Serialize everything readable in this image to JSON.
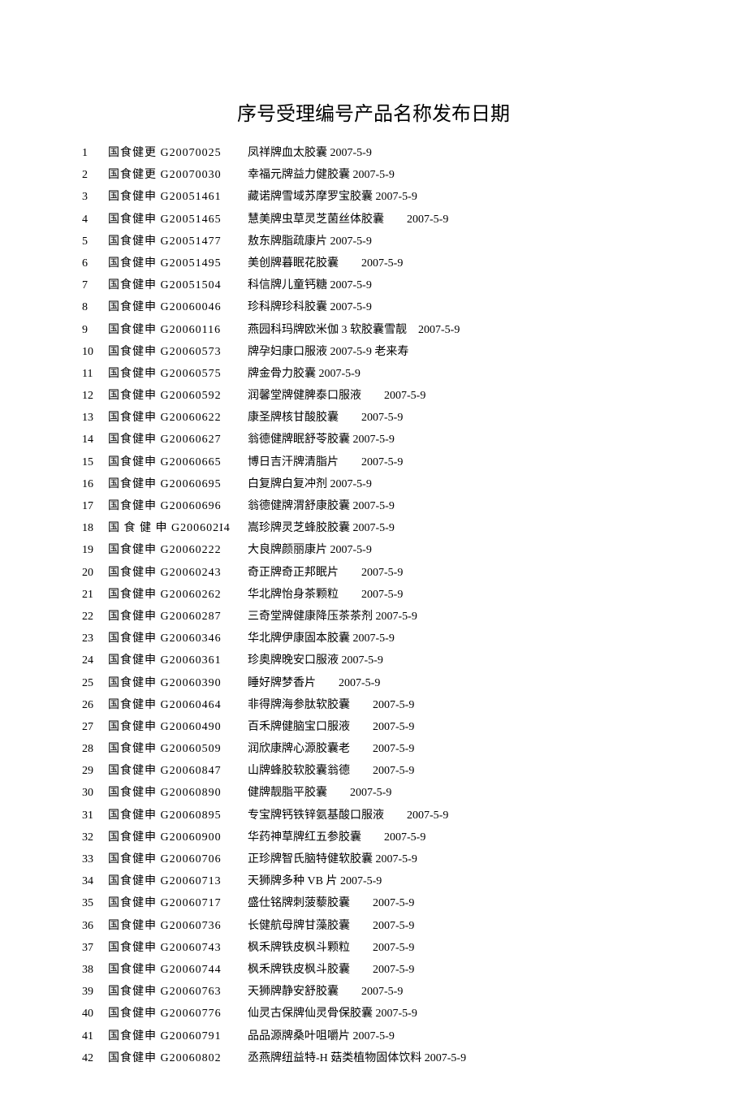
{
  "title": "序号受理编号产品名称发布日期",
  "rows": [
    {
      "seq": "1",
      "code": "国食健更 G20070025",
      "desc": "凤祥牌血太胶囊 2007-5-9"
    },
    {
      "seq": "2",
      "code": "国食健更 G20070030",
      "desc": "幸福元牌益力健胶囊 2007-5-9"
    },
    {
      "seq": "3",
      "code": "国食健申 G20051461",
      "desc": "藏诺牌雪域苏摩罗宝胶囊 2007-5-9"
    },
    {
      "seq": "4",
      "code": "国食健申 G20051465",
      "desc": "慧美牌虫草灵芝菌丝体胶囊　　2007-5-9"
    },
    {
      "seq": "5",
      "code": "国食健申 G20051477",
      "desc": "敖东牌脂疏康片 2007-5-9"
    },
    {
      "seq": "6",
      "code": "国食健申 G20051495",
      "desc": "美创牌暮眠花胶囊　　2007-5-9"
    },
    {
      "seq": "7",
      "code": "国食健申 G20051504",
      "desc": "科信牌儿童钙糖 2007-5-9"
    },
    {
      "seq": "8",
      "code": "国食健申 G20060046",
      "desc": "珍科牌珍科胶囊 2007-5-9"
    },
    {
      "seq": "9",
      "code": "国食健申 G20060116",
      "desc": "燕园科玛牌欧米伽 3 软胶囊雪靓　2007-5-9"
    },
    {
      "seq": "10",
      "code": "国食健申 G20060573",
      "desc": "牌孕妇康口服液 2007-5-9 老来寿"
    },
    {
      "seq": "11",
      "code": "国食健申 G20060575",
      "desc": "牌金骨力胶囊 2007-5-9"
    },
    {
      "seq": "12",
      "code": "国食健申 G20060592",
      "desc": "润馨堂牌健脾泰口服液　　2007-5-9"
    },
    {
      "seq": "13",
      "code": "国食健申 G20060622",
      "desc": "康圣牌核甘酸胶囊　　2007-5-9"
    },
    {
      "seq": "14",
      "code": "国食健申 G20060627",
      "desc": "翁德健牌眠舒苓胶囊 2007-5-9"
    },
    {
      "seq": "15",
      "code": "国食健申 G20060665",
      "desc": "博日吉汗牌清脂片　　2007-5-9"
    },
    {
      "seq": "16",
      "code": "国食健申 G20060695",
      "desc": "白复牌白复冲剂 2007-5-9"
    },
    {
      "seq": "17",
      "code": "国食健申 G20060696",
      "desc": "翁德健牌渭舒康胶囊 2007-5-9"
    },
    {
      "seq": "18",
      "code": "国 食 健 申 G200602I4",
      "desc": "嵩珍牌灵芝蜂胶胶囊 2007-5-9"
    },
    {
      "seq": "19",
      "code": "国食健申 G20060222",
      "desc": "大良牌颜丽康片 2007-5-9"
    },
    {
      "seq": "20",
      "code": "国食健申 G20060243",
      "desc": "奇正牌奇正邦眠片　　2007-5-9"
    },
    {
      "seq": "21",
      "code": "国食健申 G20060262",
      "desc": "华北牌怡身茶颗粒　　2007-5-9"
    },
    {
      "seq": "22",
      "code": "国食健申 G20060287",
      "desc": "三奇堂牌健康降压茶茶剂 2007-5-9"
    },
    {
      "seq": "23",
      "code": "国食健申 G20060346",
      "desc": "华北牌伊康固本胶囊 2007-5-9"
    },
    {
      "seq": "24",
      "code": "国食健申 G20060361",
      "desc": "珍奥牌晚安口服液 2007-5-9"
    },
    {
      "seq": "25",
      "code": "国食健申 G20060390",
      "desc": "睡好牌梦香片　　2007-5-9"
    },
    {
      "seq": "26",
      "code": "国食健申 G20060464",
      "desc": "非得牌海参肽软胶囊　　2007-5-9"
    },
    {
      "seq": "27",
      "code": "国食健申 G20060490",
      "desc": "百禾牌健脑宝口服液　　2007-5-9"
    },
    {
      "seq": "28",
      "code": "国食健申 G20060509",
      "desc": "润欣康牌心源胶囊老　　2007-5-9"
    },
    {
      "seq": "29",
      "code": "国食健申 G20060847",
      "desc": "山牌蜂胶软胶囊翁德　　2007-5-9"
    },
    {
      "seq": "30",
      "code": "国食健申 G20060890",
      "desc": "健牌靓脂平胶囊　　2007-5-9"
    },
    {
      "seq": "31",
      "code": "国食健申 G20060895",
      "desc": "专宝牌钙铁锌氨基酸口服液　　2007-5-9"
    },
    {
      "seq": "32",
      "code": "国食健申 G20060900",
      "desc": "华药神草牌红五参胶囊　　2007-5-9"
    },
    {
      "seq": "33",
      "code": "国食健申 G20060706",
      "desc": "正珍牌智氏脑特健软胶囊 2007-5-9"
    },
    {
      "seq": "34",
      "code": "国食健申 G20060713",
      "desc": "天狮牌多种 VB 片 2007-5-9"
    },
    {
      "seq": "35",
      "code": "国食健申 G20060717",
      "desc": "盛仕铭牌刺菠藜胶囊　　2007-5-9"
    },
    {
      "seq": "36",
      "code": "国食健申 G20060736",
      "desc": "长健航母牌甘藻胶囊　　2007-5-9"
    },
    {
      "seq": "37",
      "code": "国食健申 G20060743",
      "desc": "枫禾牌铁皮枫斗颗粒　　2007-5-9"
    },
    {
      "seq": "38",
      "code": "国食健申 G20060744",
      "desc": "枫禾牌铁皮枫斗胶囊　　2007-5-9"
    },
    {
      "seq": "39",
      "code": "国食健申 G20060763",
      "desc": "天狮牌静安舒胶囊　　2007-5-9"
    },
    {
      "seq": "40",
      "code": "国食健申 G20060776",
      "desc": "仙灵古保牌仙灵骨保胶囊 2007-5-9"
    },
    {
      "seq": "41",
      "code": "国食健申 G20060791",
      "desc": "品品源牌桑叶咀嚼片 2007-5-9"
    },
    {
      "seq": "42",
      "code": "国食健申 G20060802",
      "desc": "丞燕牌纽益特-H 菇类植物固体饮料 2007-5-9"
    }
  ]
}
